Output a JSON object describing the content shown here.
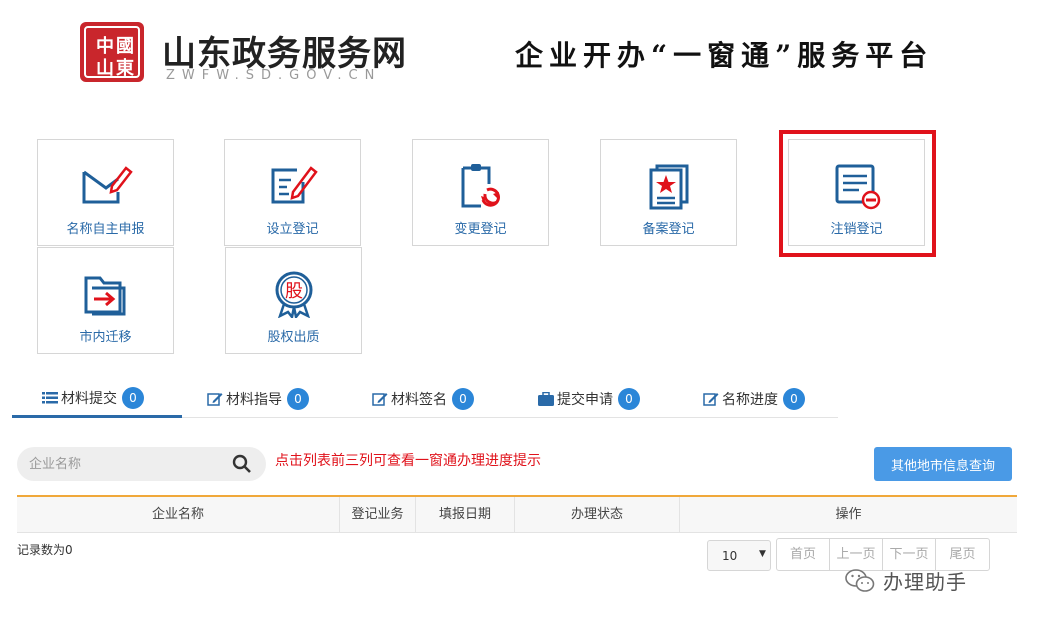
{
  "header": {
    "site_title": "山东政务服务网",
    "site_domain": "ZWFW.SD.GOV.CN",
    "platform_title": "企业开办“一窗通”服务平台",
    "seal_text": "中國山東"
  },
  "tiles": [
    {
      "label": "名称自主申报",
      "icon": "name-declare-icon"
    },
    {
      "label": "设立登记",
      "icon": "establish-icon"
    },
    {
      "label": "变更登记",
      "icon": "change-icon"
    },
    {
      "label": "备案登记",
      "icon": "record-icon"
    },
    {
      "label": "注销登记",
      "icon": "cancel-icon",
      "highlighted": true
    },
    {
      "label": "市内迁移",
      "icon": "migrate-icon"
    },
    {
      "label": "股权出质",
      "icon": "equity-icon",
      "icon_glyph": "股"
    }
  ],
  "tabs": [
    {
      "label": "材料提交",
      "count": "0",
      "active": true,
      "icon": "list-icon"
    },
    {
      "label": "材料指导",
      "count": "0",
      "icon": "edit-icon"
    },
    {
      "label": "材料签名",
      "count": "0",
      "icon": "edit-icon"
    },
    {
      "label": "提交申请",
      "count": "0",
      "icon": "briefcase-icon"
    },
    {
      "label": "名称进度",
      "count": "0",
      "icon": "edit-icon"
    }
  ],
  "search": {
    "placeholder": "企业名称"
  },
  "hint": "点击列表前三列可查看一窗通办理进度提示",
  "other_button": "其他地市信息查询",
  "table": {
    "columns": [
      "企业名称",
      "登记业务",
      "填报日期",
      "办理状态",
      "操作"
    ],
    "record_count": "记录数为0"
  },
  "pagination": {
    "page_size": "10",
    "buttons": [
      "首页",
      "上一页",
      "下一页",
      "尾页"
    ]
  },
  "watermark": "办理助手",
  "colors": {
    "accent": "#2a6aa8",
    "badge": "#2b86d8",
    "highlight": "#e0121b",
    "table_top": "#f0a83a"
  }
}
